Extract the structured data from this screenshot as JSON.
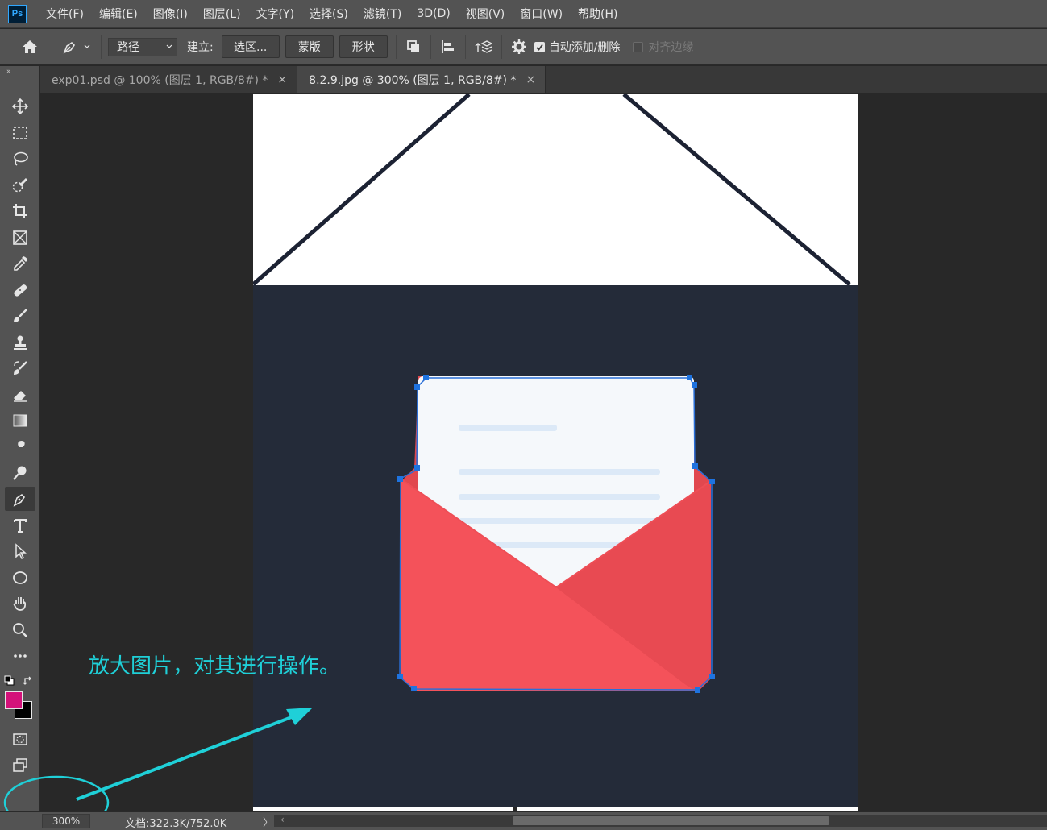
{
  "app": {
    "logo_text": "Ps",
    "menu": [
      "文件(F)",
      "编辑(E)",
      "图像(I)",
      "图层(L)",
      "文字(Y)",
      "选择(S)",
      "滤镜(T)",
      "3D(D)",
      "视图(V)",
      "窗口(W)",
      "帮助(H)"
    ]
  },
  "options_bar": {
    "mode_select": "路径",
    "build_label": "建立:",
    "selection_button": "选区...",
    "mask_button": "蒙版",
    "shape_button": "形状",
    "auto_add_delete_label": "自动添加/删除",
    "auto_add_delete_checked": true,
    "align_edges_label": "对齐边缘",
    "align_edges_checked": false
  },
  "tabs": [
    {
      "label": "exp01.psd @ 100% (图层 1, RGB/8#) *",
      "active": false
    },
    {
      "label": "8.2.9.jpg @ 300% (图层 1, RGB/8#) *",
      "active": true
    }
  ],
  "tab_close_glyph": "×",
  "tools": [
    {
      "name": "move-tool",
      "icon": "move-icon"
    },
    {
      "name": "marquee-tool",
      "icon": "rect-marquee-icon"
    },
    {
      "name": "lasso-tool",
      "icon": "lasso-icon"
    },
    {
      "name": "quick-selection-tool",
      "icon": "quick-select-icon"
    },
    {
      "name": "crop-tool",
      "icon": "crop-icon"
    },
    {
      "name": "frame-tool",
      "icon": "frame-icon"
    },
    {
      "name": "eyedropper-tool",
      "icon": "eyedropper-icon"
    },
    {
      "name": "healing-brush-tool",
      "icon": "bandage-icon"
    },
    {
      "name": "brush-tool",
      "icon": "brush-icon"
    },
    {
      "name": "clone-stamp-tool",
      "icon": "stamp-icon"
    },
    {
      "name": "history-brush-tool",
      "icon": "history-brush-icon"
    },
    {
      "name": "eraser-tool",
      "icon": "eraser-icon"
    },
    {
      "name": "gradient-tool",
      "icon": "gradient-icon"
    },
    {
      "name": "smudge-tool",
      "icon": "smudge-icon"
    },
    {
      "name": "dodge-tool",
      "icon": "dodge-icon"
    },
    {
      "name": "pen-tool",
      "icon": "pen-icon",
      "active": true
    },
    {
      "name": "type-tool",
      "icon": "type-icon"
    },
    {
      "name": "path-selection-tool",
      "icon": "arrow-icon"
    },
    {
      "name": "ellipse-tool",
      "icon": "ellipse-icon"
    },
    {
      "name": "hand-tool",
      "icon": "hand-icon"
    },
    {
      "name": "zoom-tool",
      "icon": "zoom-icon"
    },
    {
      "name": "edit-toolbar",
      "icon": "more-icon"
    }
  ],
  "colors": {
    "foreground": "#d4127a",
    "background": "#000000",
    "annotation": "#1fd0d8",
    "canvas_dark": "#242b39",
    "envelope_red": "#f4525a",
    "path_blue": "#1e6fd8"
  },
  "annotation": {
    "text": "放大图片，对其进行操作。"
  },
  "status": {
    "zoom": "300%",
    "doc_info": "文档:322.3K/752.0K",
    "arrow": "〉",
    "scroll_left": "‹"
  }
}
